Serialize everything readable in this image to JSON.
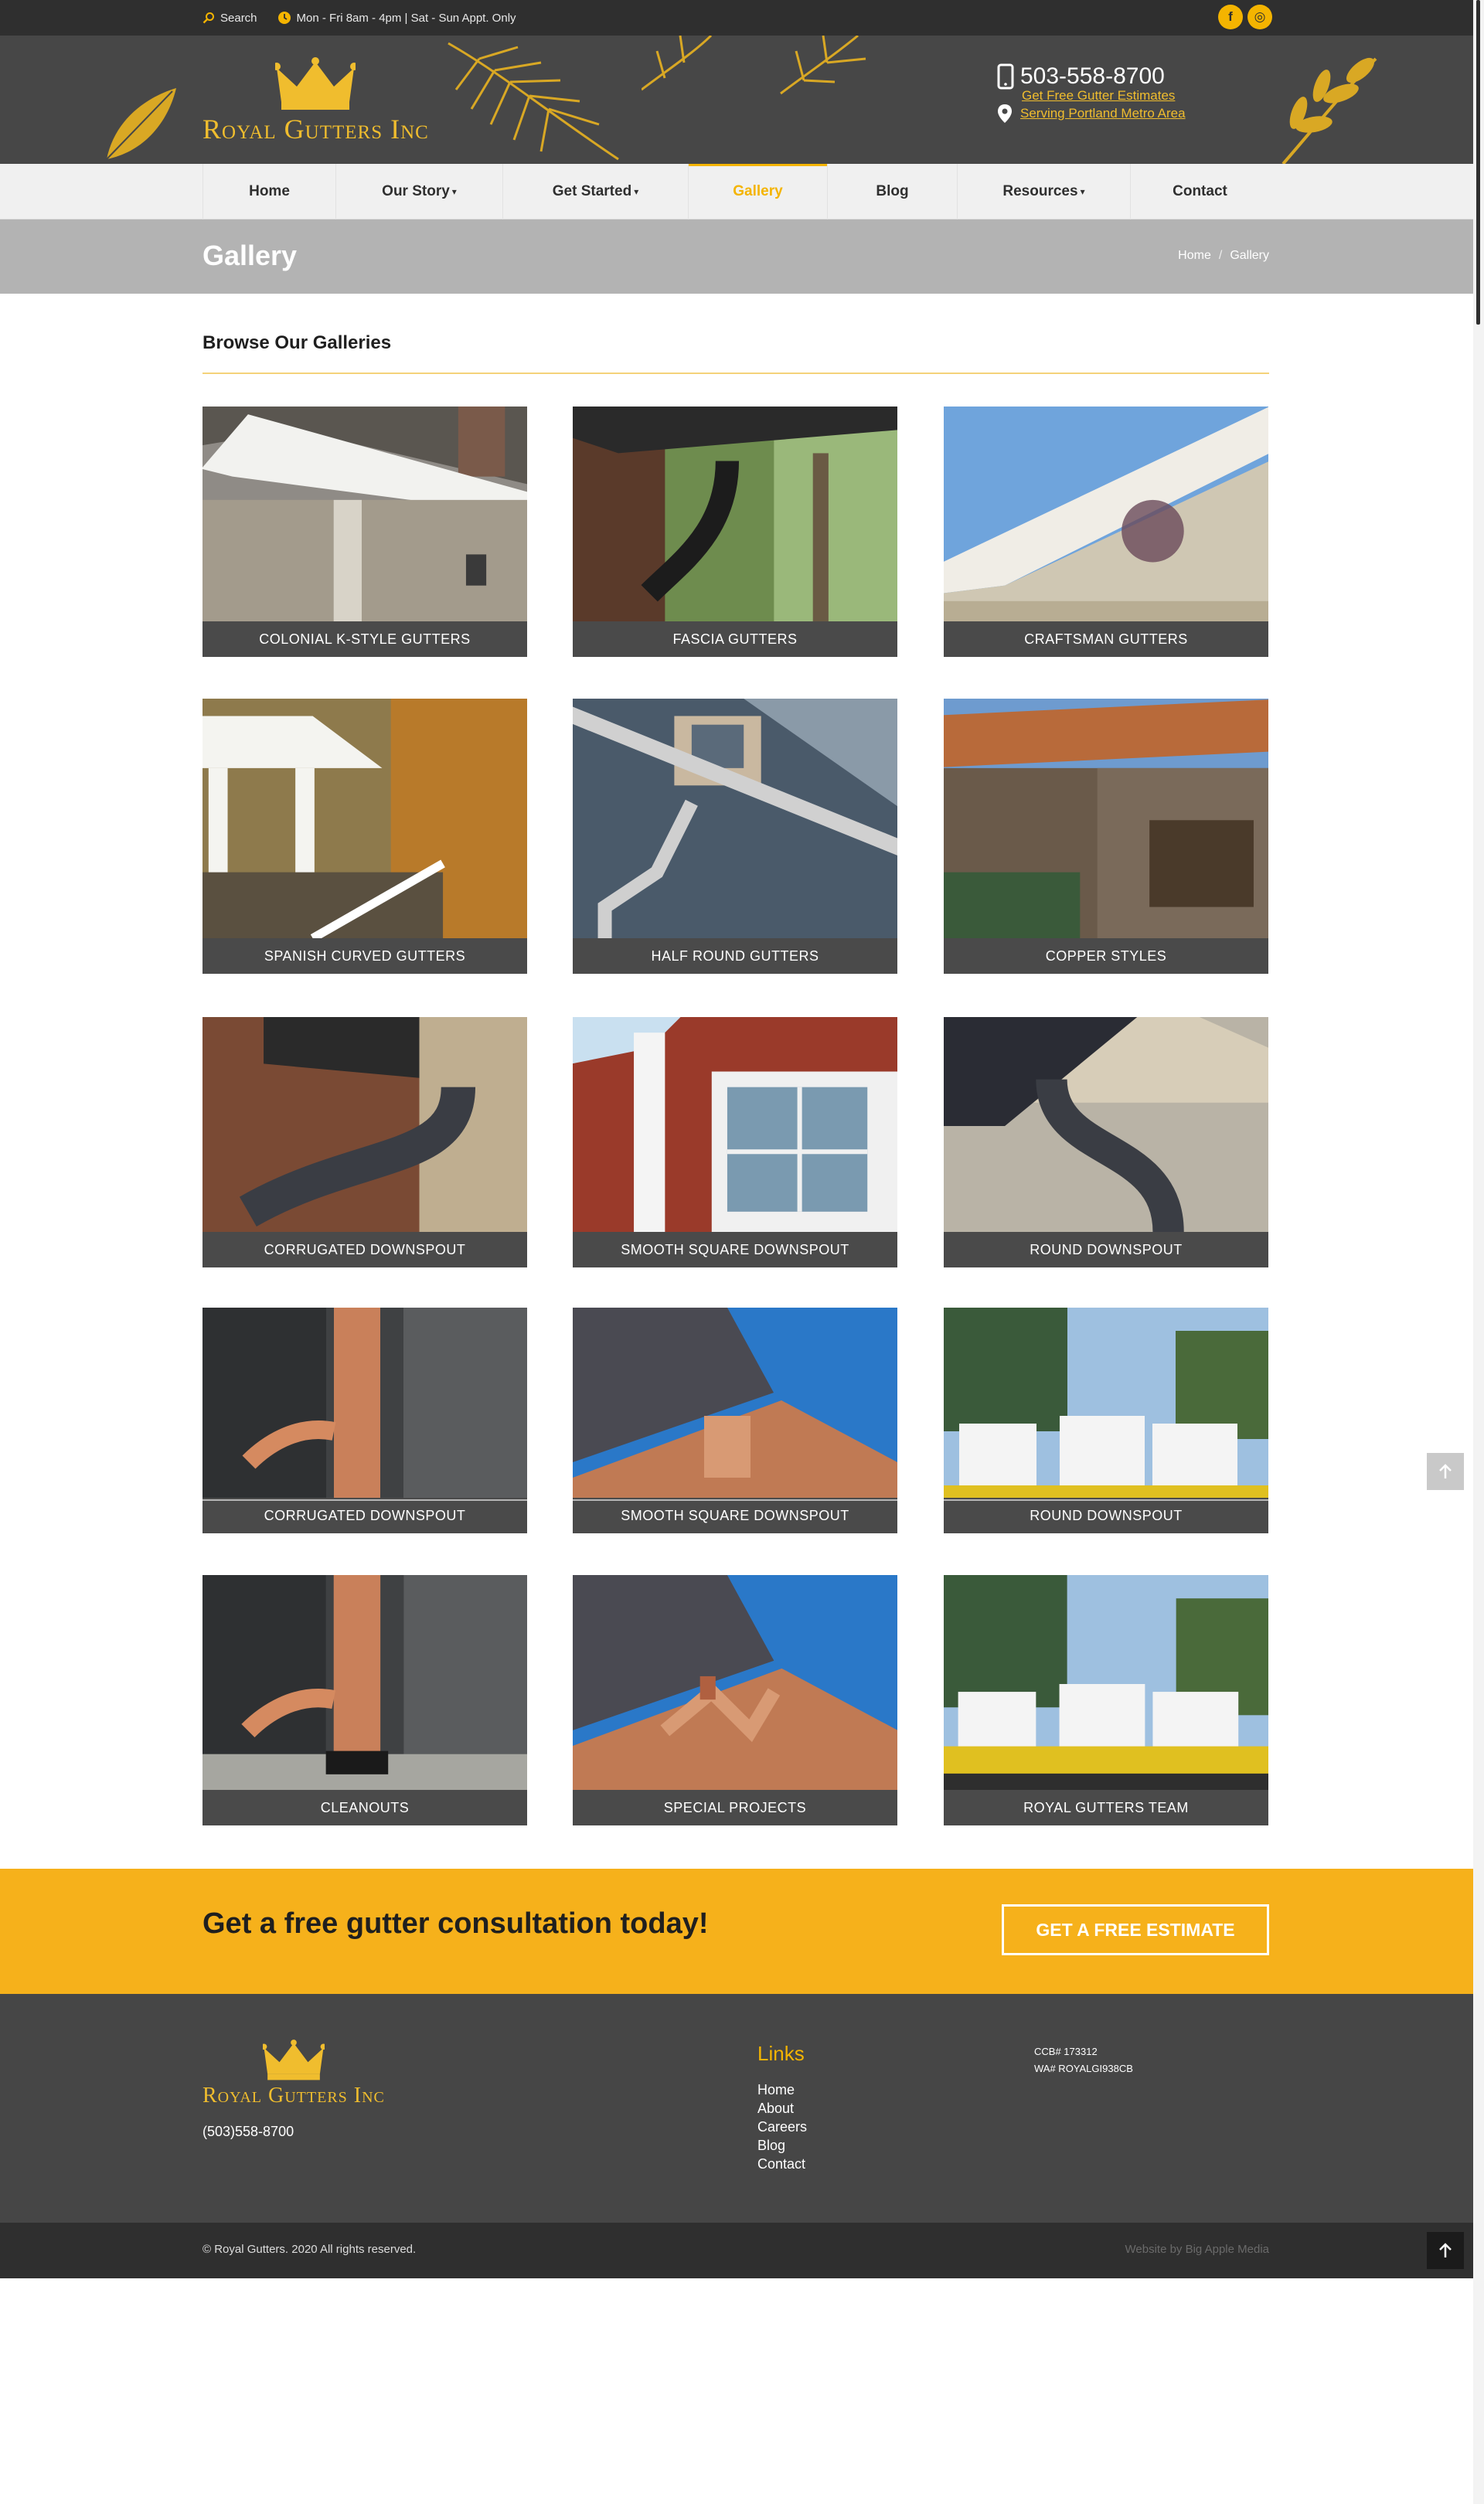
{
  "topbar": {
    "search_label": "Search",
    "hours": "Mon - Fri 8am - 4pm | Sat - Sun Appt. Only",
    "social": [
      {
        "icon": "facebook-icon",
        "glyph": "f"
      },
      {
        "icon": "instagram-icon",
        "glyph": "◎"
      }
    ]
  },
  "header": {
    "logo_text": "Royal Gutters Inc",
    "phone": "503-558-8700",
    "estimate_link": "Get Free Gutter Estimates",
    "service_area": "Serving Portland Metro Area"
  },
  "nav": {
    "items": [
      {
        "label": "Home",
        "dropdown": false,
        "active": false
      },
      {
        "label": "Our Story",
        "dropdown": true,
        "active": false
      },
      {
        "label": "Get Started",
        "dropdown": true,
        "active": false
      },
      {
        "label": "Gallery",
        "dropdown": false,
        "active": true
      },
      {
        "label": "Blog",
        "dropdown": false,
        "active": false
      },
      {
        "label": "Resources",
        "dropdown": true,
        "active": false
      },
      {
        "label": "Contact",
        "dropdown": false,
        "active": false
      }
    ]
  },
  "page": {
    "title": "Gallery",
    "breadcrumb_home": "Home",
    "breadcrumb_current": "Gallery",
    "browse_heading": "Browse Our Galleries"
  },
  "gallery": [
    {
      "caption": "Colonial K-Style Gutters"
    },
    {
      "caption": "Fascia Gutters"
    },
    {
      "caption": "Craftsman Gutters"
    },
    {
      "caption": "Spanish Curved Gutters"
    },
    {
      "caption": "Half Round Gutters"
    },
    {
      "caption": "Copper Styles"
    },
    {
      "caption": "Corrugated Downspout"
    },
    {
      "caption": "Smooth Square Downspout"
    },
    {
      "caption": "Round Downspout"
    },
    {
      "caption": "Corrugated Downspout"
    },
    {
      "caption": "Smooth Square Downspout"
    },
    {
      "caption": "Round Downspout"
    },
    {
      "caption": "Cleanouts"
    },
    {
      "caption": "Special Projects"
    },
    {
      "caption": "Royal Gutters Team"
    }
  ],
  "cta": {
    "heading": "Get a free gutter consultation today!",
    "button": "GET A FREE ESTIMATE"
  },
  "footer": {
    "logo_text": "Royal Gutters Inc",
    "phone": "(503)558-8700",
    "links_title": "Links",
    "links": [
      "Home",
      "About",
      "Careers",
      "Blog",
      "Contact"
    ],
    "license_ccb": "CCB# 173312",
    "license_wa": "WA# ROYALGI938CB",
    "copyright": "© Royal Gutters. 2020 All rights reserved.",
    "credit": "Website by Big Apple Media"
  },
  "colors": {
    "accent": "#f4b400",
    "dark": "#2f2f2f",
    "header": "#474747",
    "cta": "#f6b11b"
  }
}
